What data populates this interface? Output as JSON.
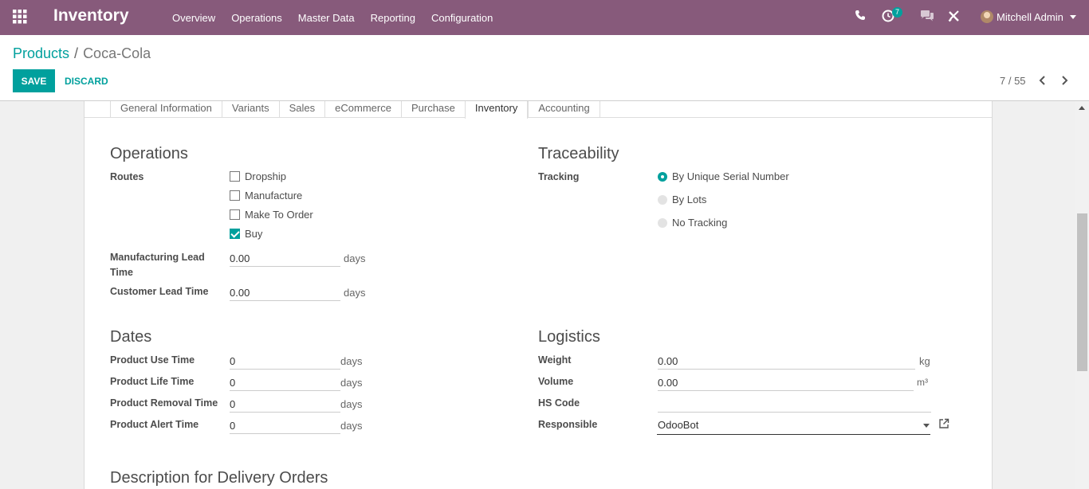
{
  "navbar": {
    "brand": "Inventory",
    "menu": [
      "Overview",
      "Operations",
      "Master Data",
      "Reporting",
      "Configuration"
    ],
    "activity_count": "7",
    "user_name": "Mitchell Admin"
  },
  "control": {
    "breadcrumb_parent": "Products",
    "breadcrumb_separator": "/",
    "breadcrumb_current": "Coca-Cola",
    "save_label": "SAVE",
    "discard_label": "DISCARD",
    "pager": "7 / 55"
  },
  "tabs": [
    "General Information",
    "Variants",
    "Sales",
    "eCommerce",
    "Purchase",
    "Inventory",
    "Accounting"
  ],
  "active_tab": "Inventory",
  "operations": {
    "title": "Operations",
    "routes_label": "Routes",
    "routes": [
      {
        "label": "Dropship",
        "checked": false
      },
      {
        "label": "Manufacture",
        "checked": false
      },
      {
        "label": "Make To Order",
        "checked": false
      },
      {
        "label": "Buy",
        "checked": true
      }
    ],
    "mfg_lead_label_1": "Manufacturing Lead",
    "mfg_lead_label_2": "Time",
    "mfg_lead_value": "0.00",
    "mfg_lead_unit": "days",
    "cust_lead_label": "Customer Lead Time",
    "cust_lead_value": "0.00",
    "cust_lead_unit": "days"
  },
  "traceability": {
    "title": "Traceability",
    "tracking_label": "Tracking",
    "options": [
      {
        "label": "By Unique Serial Number",
        "selected": true
      },
      {
        "label": "By Lots",
        "selected": false
      },
      {
        "label": "No Tracking",
        "selected": false
      }
    ]
  },
  "dates": {
    "title": "Dates",
    "rows": [
      {
        "label": "Product Use Time",
        "value": "0",
        "unit": "days"
      },
      {
        "label": "Product Life Time",
        "value": "0",
        "unit": "days"
      },
      {
        "label": "Product Removal Time",
        "value": "0",
        "unit": "days"
      },
      {
        "label": "Product Alert Time",
        "value": "0",
        "unit": "days"
      }
    ]
  },
  "logistics": {
    "title": "Logistics",
    "weight_label": "Weight",
    "weight_value": "0.00",
    "weight_unit": "kg",
    "volume_label": "Volume",
    "volume_value": "0.00",
    "volume_unit": "m³",
    "hs_code_label": "HS Code",
    "hs_code_value": "",
    "responsible_label": "Responsible",
    "responsible_value": "OdooBot"
  },
  "description_delivery_title": "Description for Delivery Orders",
  "colors": {
    "navbar": "#875a7b",
    "accent": "#00a09d"
  }
}
